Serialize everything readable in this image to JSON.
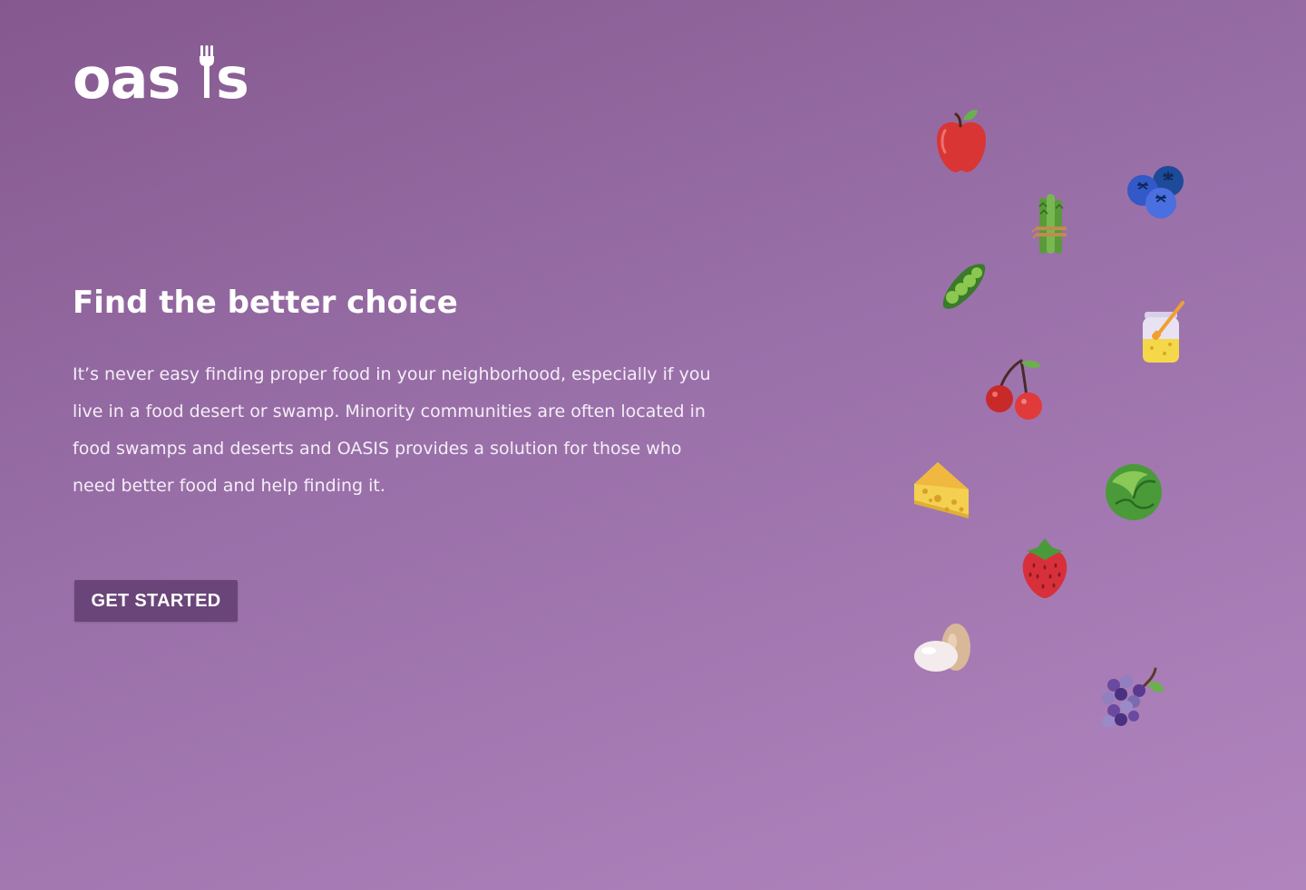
{
  "brand": {
    "logo_text": "oasis"
  },
  "hero": {
    "headline": "Find the better choice",
    "description": "It’s never easy finding proper food in your neighborhood, especially if you live in a food desert or swamp. Minority communities are often located in food swamps and deserts and OASIS provides a solution for those who need better food and help finding it.",
    "cta_label": "GET STARTED"
  },
  "illustrations": [
    "apple-icon",
    "blueberries-icon",
    "asparagus-icon",
    "peas-icon",
    "honey-jar-icon",
    "cherries-icon",
    "cheese-icon",
    "cabbage-icon",
    "strawberry-icon",
    "eggs-icon",
    "grapes-icon"
  ],
  "colors": {
    "background_start": "#85598f",
    "background_end": "#b184be",
    "button": "#6a4579",
    "text": "#ffffff"
  }
}
